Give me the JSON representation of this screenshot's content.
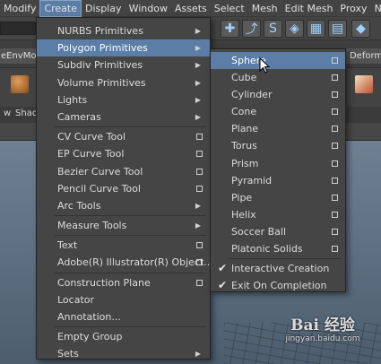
{
  "menubar": {
    "items": [
      "Modify",
      "Create",
      "Display",
      "Window",
      "Assets",
      "Select",
      "Mesh",
      "Edit Mesh",
      "Proxy",
      "Nor"
    ],
    "active": "Create"
  },
  "background": {
    "left_tab": "eEnvMod",
    "right_tab": "Deform",
    "view_label": "w",
    "shade_label": "Shad"
  },
  "create_menu": {
    "items": [
      {
        "label": "NURBS Primitives",
        "type": "submenu"
      },
      {
        "label": "Polygon Primitives",
        "type": "submenu",
        "highlight": true
      },
      {
        "label": "Subdiv Primitives",
        "type": "submenu"
      },
      {
        "label": "Volume Primitives",
        "type": "submenu"
      },
      {
        "label": "Lights",
        "type": "submenu"
      },
      {
        "label": "Cameras",
        "type": "submenu"
      },
      {
        "type": "separator"
      },
      {
        "label": "CV Curve Tool",
        "type": "option"
      },
      {
        "label": "EP Curve Tool",
        "type": "option"
      },
      {
        "label": "Bezier Curve Tool",
        "type": "option"
      },
      {
        "label": "Pencil Curve Tool",
        "type": "option"
      },
      {
        "label": "Arc Tools",
        "type": "submenu"
      },
      {
        "type": "separator"
      },
      {
        "label": "Measure Tools",
        "type": "submenu"
      },
      {
        "type": "separator"
      },
      {
        "label": "Text",
        "type": "option"
      },
      {
        "label": "Adobe(R) Illustrator(R) Object...",
        "type": "option"
      },
      {
        "type": "separator"
      },
      {
        "label": "Construction Plane",
        "type": "option"
      },
      {
        "label": "Locator",
        "type": "plain"
      },
      {
        "label": "Annotation...",
        "type": "plain"
      },
      {
        "type": "separator"
      },
      {
        "label": "Empty Group",
        "type": "plain"
      },
      {
        "label": "Sets",
        "type": "submenu"
      }
    ]
  },
  "poly_menu": {
    "items": [
      {
        "label": "Sphere",
        "type": "option",
        "highlight": true
      },
      {
        "label": "Cube",
        "type": "option"
      },
      {
        "label": "Cylinder",
        "type": "option"
      },
      {
        "label": "Cone",
        "type": "option"
      },
      {
        "label": "Plane",
        "type": "option"
      },
      {
        "label": "Torus",
        "type": "option"
      },
      {
        "label": "Prism",
        "type": "option"
      },
      {
        "label": "Pyramid",
        "type": "option"
      },
      {
        "label": "Pipe",
        "type": "option"
      },
      {
        "label": "Helix",
        "type": "option"
      },
      {
        "label": "Soccer Ball",
        "type": "option"
      },
      {
        "label": "Platonic Solids",
        "type": "option"
      },
      {
        "type": "separator"
      },
      {
        "label": "Interactive Creation",
        "type": "check",
        "checked": true
      },
      {
        "label": "Exit On Completion",
        "type": "check",
        "checked": true
      }
    ]
  },
  "watermark": {
    "logo": "Bai 经验",
    "url": "jingyan.baidu.com"
  },
  "colors": {
    "menu_bg": "#454545",
    "highlight": "#5b7da6",
    "text": "#dcdcdc"
  }
}
